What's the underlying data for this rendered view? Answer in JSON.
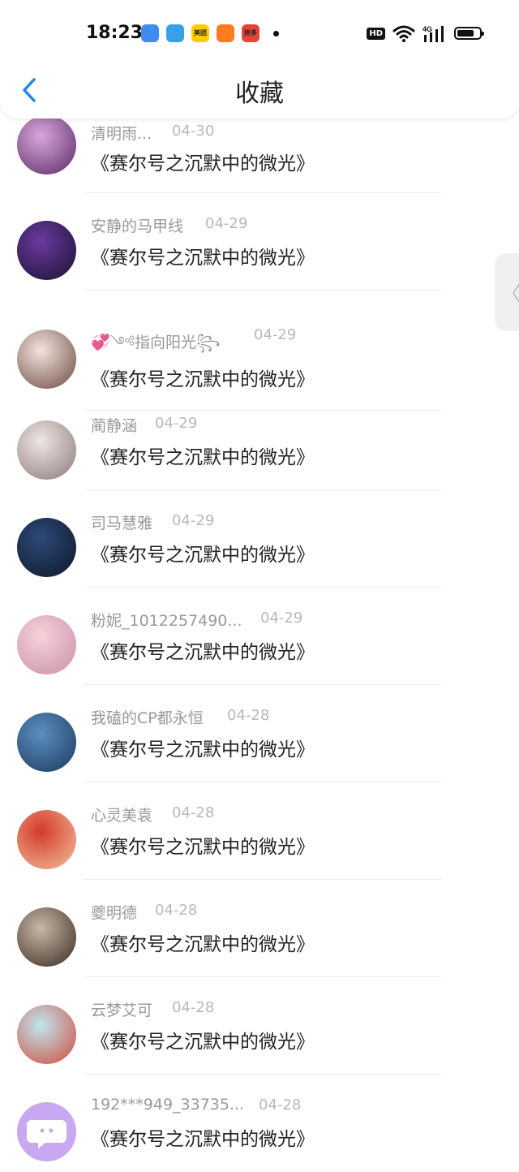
{
  "status_bar": {
    "time": "18:23",
    "apps": [
      {
        "name": "blue-app-icon",
        "color": "#3f8cf0",
        "text": ""
      },
      {
        "name": "circle-app-icon",
        "color": "#36a0e8",
        "text": ""
      },
      {
        "name": "meituan-icon",
        "color": "#ffcc00",
        "text": "美团"
      },
      {
        "name": "orange-app-icon",
        "color": "#ff7a21",
        "text": ""
      },
      {
        "name": "red-app-icon",
        "color": "#e84338",
        "text": "拼多多"
      }
    ],
    "hd": "HD",
    "network": "4G"
  },
  "header": {
    "title": "收藏"
  },
  "items": [
    {
      "user": "清明雨...",
      "date": "04-30",
      "text": "《赛尔号之沉默中的微光》",
      "avatar": [
        "#d9a7d8",
        "#5a2a6a"
      ]
    },
    {
      "user": "安静的马甲线",
      "date": "04-29",
      "text": "《赛尔号之沉默中的微光》",
      "avatar": [
        "#6a3aa0",
        "#1a1030"
      ]
    },
    {
      "user": "💞༺指向阳光꧂",
      "date": "04-29",
      "text": "《赛尔号之沉默中的微光》",
      "avatar": [
        "#f3e3df",
        "#6b4a40"
      ]
    },
    {
      "user": "蔺静涵",
      "date": "04-29",
      "text": "《赛尔号之沉默中的微光》",
      "avatar": [
        "#efe6e6",
        "#8a7a78"
      ]
    },
    {
      "user": "司马慧雅",
      "date": "04-29",
      "text": "《赛尔号之沉默中的微光》",
      "avatar": [
        "#2d4a78",
        "#0d1628"
      ]
    },
    {
      "user": "粉妮_1012257490...",
      "date": "04-29",
      "text": "《赛尔号之沉默中的微光》",
      "avatar": [
        "#f6d2da",
        "#c88fa8"
      ]
    },
    {
      "user": "我磕的CP都永恒",
      "date": "04-28",
      "text": "《赛尔号之沉默中的微光》",
      "avatar": [
        "#5a8fc0",
        "#1c3a5c"
      ]
    },
    {
      "user": "心灵美袁",
      "date": "04-28",
      "text": "《赛尔号之沉默中的微光》",
      "avatar": [
        "#d33a2a",
        "#f4c0a0"
      ]
    },
    {
      "user": "夔明德",
      "date": "04-28",
      "text": "《赛尔号之沉默中的微光》",
      "avatar": [
        "#c8b8a8",
        "#3a2a20"
      ]
    },
    {
      "user": "云梦艾可",
      "date": "04-28",
      "text": "《赛尔号之沉默中的微光》",
      "avatar": [
        "#bfe6ef",
        "#d24a3a"
      ]
    },
    {
      "user": "192***949_33735...",
      "date": "04-28",
      "text": "《赛尔号之沉默中的微光》",
      "avatar": [
        "#c8a8f0",
        "#c8a8f0"
      ]
    }
  ],
  "colors": {
    "accent": "#1e88e5"
  }
}
